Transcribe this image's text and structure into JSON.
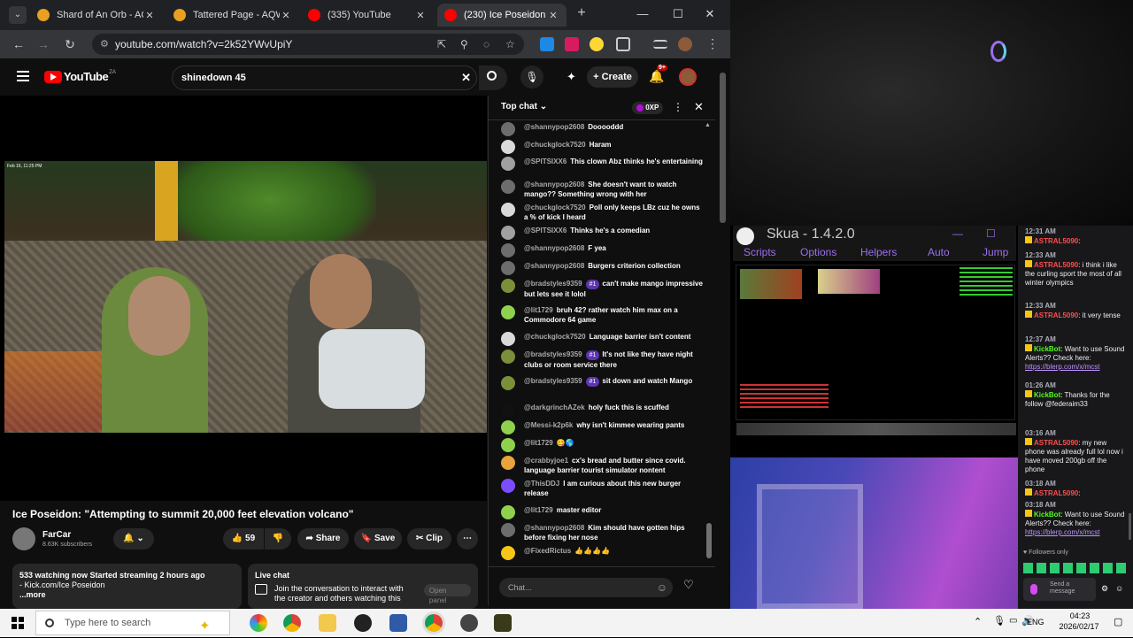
{
  "tabs": [
    {
      "label": "Shard of An Orb - AQW",
      "icon": "aqw-icon",
      "active": false
    },
    {
      "label": "Tattered Page - AQW",
      "icon": "aqw-icon",
      "active": false
    },
    {
      "label": "(335) YouTube",
      "icon": "youtube-icon",
      "active": false
    },
    {
      "label": "(230) Ice Poseidon",
      "icon": "youtube-icon",
      "active": true
    }
  ],
  "address": {
    "url": "youtube.com/watch?v=2k52YWvUpiY"
  },
  "youtube": {
    "logo": "YouTube",
    "region": "ZA",
    "search_value": "shinedown 45",
    "create_label": "Create",
    "notif_count": "9+"
  },
  "video": {
    "overlay_time": "Feb 16, 11:25 PM",
    "title": "Ice Poseidon: \"Attempting to summit 20,000 feet elevation volcano\"",
    "channel": "FarCar",
    "subscribers": "8.63K subscribers",
    "likes": "59",
    "share_label": "Share",
    "save_label": "Save",
    "clip_label": "Clip",
    "description": {
      "stats": "533 watching now  Started streaming 2 hours ago",
      "line2": "- Kick.com/Ice Poseidon",
      "more": "...more"
    },
    "livechat": {
      "title": "Live chat",
      "text": "Join the conversation to interact with the creator and others watching this live",
      "open_label": "Open panel"
    }
  },
  "chat": {
    "mode": "Top chat",
    "points": "0XP",
    "input_placeholder": "Chat...",
    "messages": [
      {
        "author": "@shannypop2608",
        "text": "Dooooddd",
        "badge": "",
        "color": "#6d6d6d"
      },
      {
        "author": "@chuckglock7520",
        "text": "Haram",
        "badge": "",
        "color": "#d9d9d9"
      },
      {
        "author": "@SPITSIXX6",
        "text": "This clown Abz thinks he's entertaining",
        "badge": "",
        "color": "#a0a0a0"
      },
      {
        "author": "@shannypop2608",
        "text": "She doesn't want to watch mango?? Something wrong with her",
        "badge": "",
        "color": "#6d6d6d"
      },
      {
        "author": "@chuckglock7520",
        "text": "Poll only keeps LBz cuz he owns a % of kick I heard",
        "badge": "",
        "color": "#d9d9d9"
      },
      {
        "author": "@SPITSIXX6",
        "text": "Thinks he's a comedian",
        "badge": "",
        "color": "#a0a0a0"
      },
      {
        "author": "@shannypop2608",
        "text": "F yea",
        "badge": "",
        "color": "#6d6d6d"
      },
      {
        "author": "@shannypop2608",
        "text": "Burgers criterion collection",
        "badge": "",
        "color": "#6d6d6d"
      },
      {
        "author": "@bradstyles9359",
        "text": "can't make mango impressive but lets see it lolol",
        "badge": "#1",
        "color": "#7b8f3a"
      },
      {
        "author": "@lit1729",
        "text": "bruh 42? rather watch him max on a Commodore 64 game",
        "badge": "",
        "color": "#8fd14f"
      },
      {
        "author": "@chuckglock7520",
        "text": "Language barrier isn't content",
        "badge": "",
        "color": "#d9d9d9"
      },
      {
        "author": "@bradstyles9359",
        "text": "It's not like they have night clubs or room service there",
        "badge": "#1",
        "color": "#7b8f3a"
      },
      {
        "author": "@bradstyles9359",
        "text": "sit down and watch Mango",
        "badge": "#1",
        "color": "#7b8f3a"
      },
      {
        "author": "@darkgrinchAZek",
        "text": "holy fuck this is scuffed",
        "badge": "",
        "color": "#111111"
      },
      {
        "author": "@Messi-k2p6k",
        "text": "why isn't kimmee wearing pants",
        "badge": "",
        "color": "#8fd14f"
      },
      {
        "author": "@lit1729",
        "text": "😋🌎",
        "badge": "",
        "color": "#8fd14f"
      },
      {
        "author": "@crabbyjoe1",
        "text": "cx's bread and butter since covid. language barrier tourist simulator nontent",
        "badge": "",
        "color": "#e8a33c"
      },
      {
        "author": "@ThisDDJ",
        "text": "I am curious about this new burger release",
        "badge": "",
        "color": "#7c4dff"
      },
      {
        "author": "@lit1729",
        "text": "master editor",
        "badge": "",
        "color": "#8fd14f"
      },
      {
        "author": "@shannypop2608",
        "text": "Kim should have gotten hips before fixing her nose",
        "badge": "",
        "color": "#6d6d6d"
      },
      {
        "author": "@FixedRictus",
        "text": "👍👍👍👍",
        "badge": "",
        "color": "#f5c518"
      }
    ]
  },
  "skua": {
    "title": "Skua - 1.4.2.0",
    "menu": [
      "Scripts",
      "Options",
      "Helpers",
      "Auto",
      "Jump"
    ]
  },
  "twitch": {
    "messages": [
      {
        "time": "12:31 AM",
        "user": "ASTRAL5090",
        "text": "",
        "link": ""
      },
      {
        "time": "12:33 AM",
        "user": "ASTRAL5090",
        "text": "i think i like the curling sport the most of all winter olympics",
        "link": ""
      },
      {
        "time": "12:33 AM",
        "user": "ASTRAL5090",
        "text": "it very tense",
        "link": ""
      },
      {
        "time": "12:37 AM",
        "user": "KickBot",
        "text": "Want to use Sound Alerts?? Check here:",
        "link": "https://blerp.com/x/mcst"
      },
      {
        "time": "01:26 AM",
        "user": "KickBot",
        "text": "Thanks for the follow @federaim33",
        "link": ""
      },
      {
        "time": "03:16 AM",
        "user": "ASTRAL5090",
        "text": "my new phone was already full lol now i have moved 200gb off the phone",
        "link": ""
      },
      {
        "time": "03:18 AM",
        "user": "ASTRAL5090",
        "text": "",
        "link": ""
      },
      {
        "time": "03:18 AM",
        "user": "KickBot",
        "text": "Want to use Sound Alerts?? Check here:",
        "link": "https://blerp.com/x/mcst"
      }
    ],
    "followers_only": "Followers only",
    "send_placeholder": "Send a message"
  },
  "taskbar": {
    "search_placeholder": "Type here to search",
    "lang": "ENG",
    "time": "04:23",
    "date": "2026/02/17"
  }
}
